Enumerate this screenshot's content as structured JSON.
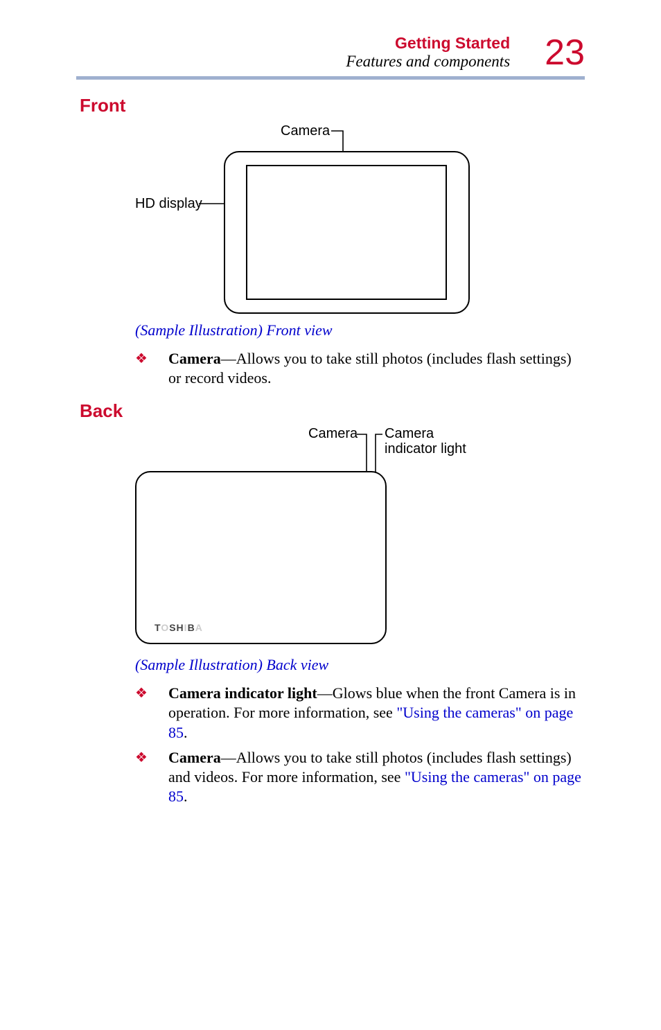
{
  "header": {
    "section": "Getting Started",
    "subsection": "Features and components",
    "page_number": "23"
  },
  "front": {
    "heading": "Front",
    "labels": {
      "camera": "Camera",
      "hd_display": "HD display"
    },
    "caption": "(Sample Illustration) Front view",
    "bullets": [
      {
        "lead": "Camera",
        "rest": "—Allows you to take still photos (includes flash settings) or record videos."
      }
    ]
  },
  "back": {
    "heading": "Back",
    "labels": {
      "camera": "Camera",
      "indicator_line1": "Camera",
      "indicator_line2": "indicator light"
    },
    "logo_parts": [
      "T",
      "O",
      "S",
      "H",
      "I",
      "B",
      "A"
    ],
    "caption": "(Sample Illustration) Back view",
    "bullets": [
      {
        "lead": "Camera indicator light",
        "rest1": "—Glows blue when the front Camera is in operation. For more information, see ",
        "link": "\"Using the cameras\" on page 85",
        "rest2": "."
      },
      {
        "lead": "Camera",
        "rest1": "—Allows you to take still photos (includes flash settings) and videos. For more information, see ",
        "link": "\"Using the cameras\" on page 85",
        "rest2": "."
      }
    ]
  }
}
